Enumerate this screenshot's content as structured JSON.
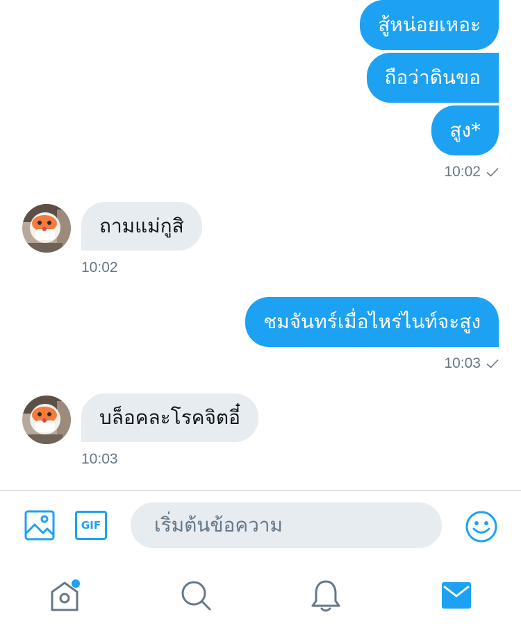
{
  "conversation": {
    "messages": [
      {
        "direction": "out",
        "text": "สู้หน่อยเหอะ"
      },
      {
        "direction": "out",
        "text": "ถือว่าดินขอ"
      },
      {
        "direction": "out",
        "text": "สูง*",
        "time": "10:02",
        "read_receipt": "check-icon"
      },
      {
        "direction": "in",
        "text": "ถามแม่กูสิ",
        "time": "10:02"
      },
      {
        "direction": "out",
        "text": "ชมจันทร์เมื่อไหร่ไนท์จะสูง",
        "time": "10:03",
        "read_receipt": "check-icon"
      },
      {
        "direction": "in",
        "text": "บล็อคละโรคจิตอี๋",
        "time": "10:03"
      }
    ]
  },
  "composer": {
    "placeholder": "เริ่มต้นข้อความ",
    "image_button": "image-icon",
    "gif_label": "GIF",
    "emoji_button": "emoji-icon"
  },
  "tabbar": {
    "items": [
      {
        "name": "home",
        "icon": "home-icon",
        "badge": true
      },
      {
        "name": "search",
        "icon": "search-icon"
      },
      {
        "name": "notifications",
        "icon": "bell-icon"
      },
      {
        "name": "messages",
        "icon": "mail-icon",
        "active": true
      }
    ]
  },
  "colors": {
    "accent": "#1da1f2",
    "incoming_bubble": "#e6ecf0",
    "muted_text": "#657786",
    "tab_icon": "#657786"
  }
}
